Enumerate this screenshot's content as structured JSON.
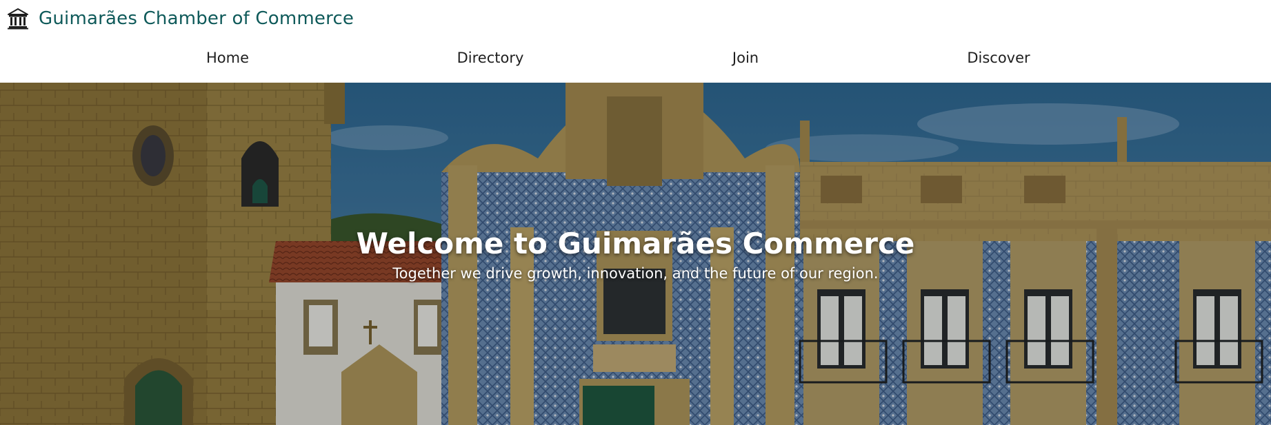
{
  "header": {
    "brand_icon": "bank-building-icon",
    "brand_name": "Guimarães Chamber of Commerce",
    "brand_color": "#0f5a5a"
  },
  "nav": {
    "items": [
      {
        "label": "Home"
      },
      {
        "label": "Directory"
      },
      {
        "label": "Join"
      },
      {
        "label": "Discover"
      }
    ]
  },
  "hero": {
    "title": "Welcome to Guimarães Commerce",
    "subtitle": "Together we drive growth, innovation, and the future of our region."
  }
}
